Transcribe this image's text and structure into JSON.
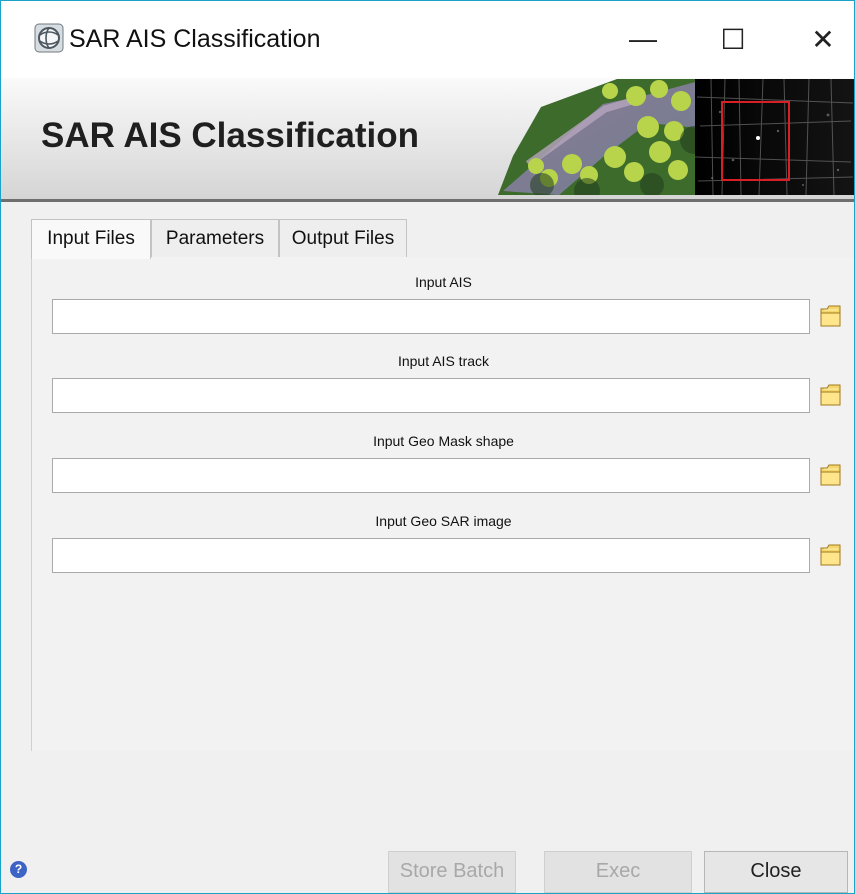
{
  "window": {
    "title": "SAR AIS Classification",
    "controls": {
      "minimize": "—",
      "maximize": "☐",
      "close": "✕"
    }
  },
  "banner": {
    "title": "SAR AIS Classification"
  },
  "tabs": [
    {
      "label": "Input Files",
      "active": true
    },
    {
      "label": "Parameters",
      "active": false
    },
    {
      "label": "Output Files",
      "active": false
    }
  ],
  "fields": [
    {
      "label": "Input AIS",
      "value": "",
      "icon": "folder-icon"
    },
    {
      "label": "Input AIS track",
      "value": "",
      "icon": "folder-icon"
    },
    {
      "label": "Input Geo Mask shape",
      "value": "",
      "icon": "folder-icon"
    },
    {
      "label": "Input Geo SAR image",
      "value": "",
      "icon": "folder-icon"
    }
  ],
  "footer": {
    "help_icon": "help-icon",
    "help_symbol": "?",
    "store_batch": "Store Batch",
    "exec": "Exec",
    "close": "Close"
  },
  "colors": {
    "window_border": "#1aa3c8",
    "panel_background": "#f0f0f0",
    "help_blue": "#3d63c4",
    "selection_red": "#d81f26"
  }
}
